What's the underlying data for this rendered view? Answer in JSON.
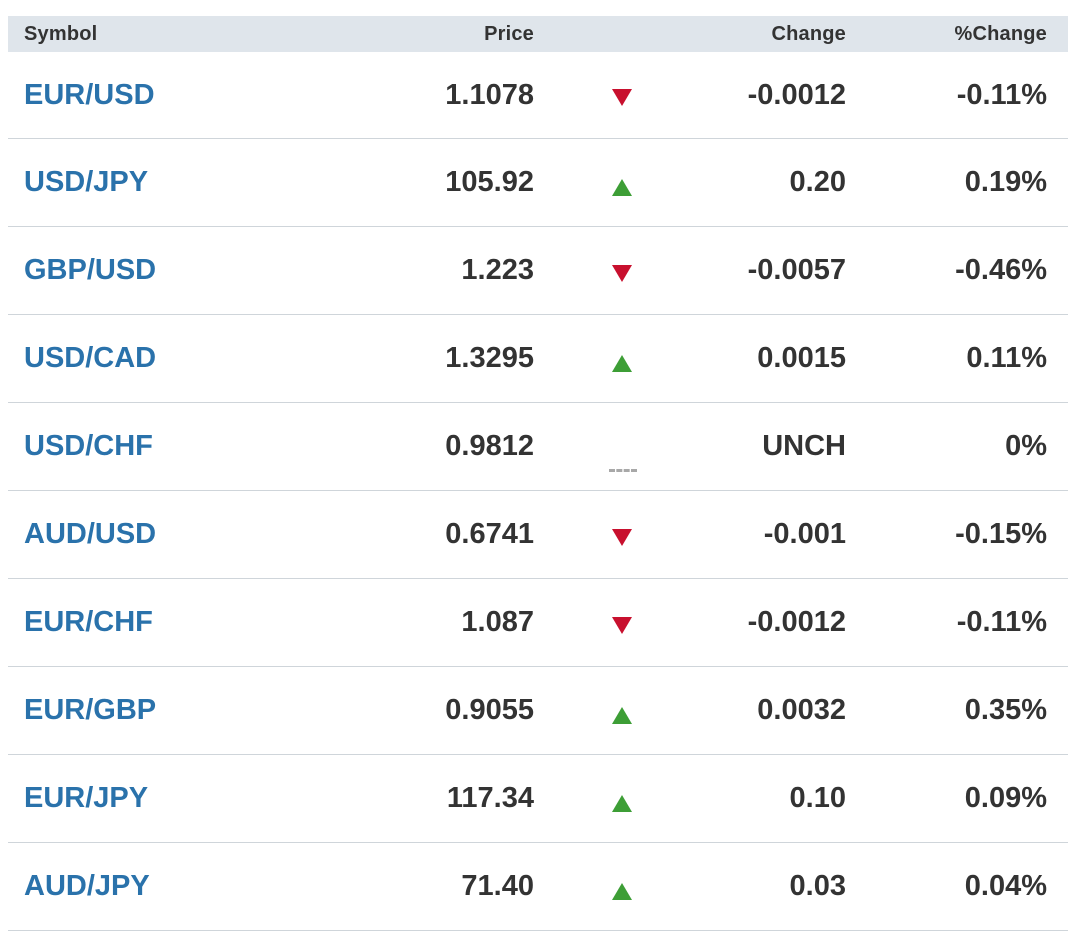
{
  "header": {
    "symbol": "Symbol",
    "price": "Price",
    "change": "Change",
    "pct_change": "%Change"
  },
  "rows": [
    {
      "symbol": "EUR/USD",
      "price": "1.1078",
      "direction": "down",
      "change": "-0.0012",
      "pct": "-0.11%"
    },
    {
      "symbol": "USD/JPY",
      "price": "105.92",
      "direction": "up",
      "change": "0.20",
      "pct": "0.19%"
    },
    {
      "symbol": "GBP/USD",
      "price": "1.223",
      "direction": "down",
      "change": "-0.0057",
      "pct": "-0.46%"
    },
    {
      "symbol": "USD/CAD",
      "price": "1.3295",
      "direction": "up",
      "change": "0.0015",
      "pct": "0.11%"
    },
    {
      "symbol": "USD/CHF",
      "price": "0.9812",
      "direction": "unch",
      "change": "UNCH",
      "pct": "0%"
    },
    {
      "symbol": "AUD/USD",
      "price": "0.6741",
      "direction": "down",
      "change": "-0.001",
      "pct": "-0.15%"
    },
    {
      "symbol": "EUR/CHF",
      "price": "1.087",
      "direction": "down",
      "change": "-0.0012",
      "pct": "-0.11%"
    },
    {
      "symbol": "EUR/GBP",
      "price": "0.9055",
      "direction": "up",
      "change": "0.0032",
      "pct": "0.35%"
    },
    {
      "symbol": "EUR/JPY",
      "price": "117.34",
      "direction": "up",
      "change": "0.10",
      "pct": "0.09%"
    },
    {
      "symbol": "AUD/JPY",
      "price": "71.40",
      "direction": "up",
      "change": "0.03",
      "pct": "0.04%"
    }
  ],
  "colors": {
    "link": "#2a72ab",
    "up": "#3d9e36",
    "down": "#c8102e",
    "header_bg": "#dfe5eb"
  }
}
